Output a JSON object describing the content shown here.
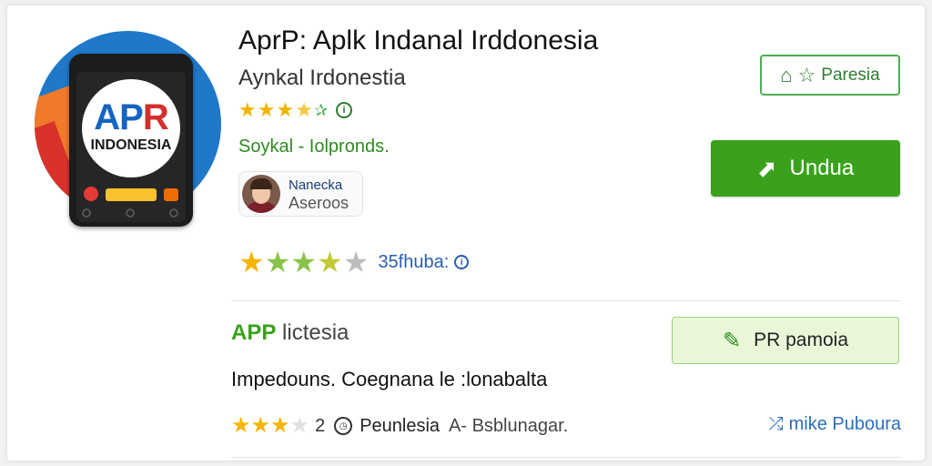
{
  "app": {
    "title": "AprP: Aplk Indanal Irddonesia",
    "subtitle": "Aynkal Irdonestia",
    "category": "Soykal - Iolpronds.",
    "icon_logo_text": "APR",
    "icon_logo_sub": "INDONESIA"
  },
  "developer": {
    "name": "Nanecka",
    "subtitle": "Aseroos"
  },
  "top_rating": {
    "stars": 3.5,
    "icon": "info-icon"
  },
  "rating_summary": {
    "stars": 3.5,
    "text": "35fhuba:",
    "icon": "info-icon"
  },
  "buttons": {
    "wishlist_label": "Paresia",
    "wishlist_icons": [
      "home-icon",
      "star-icon"
    ],
    "download_label": "Undua",
    "download_icon": "share-icon",
    "secondary_label": "PR pamoia",
    "secondary_icon": "edit-icon"
  },
  "section": {
    "title_brand": "APP",
    "title_rest": "lictesia",
    "description": "Impedouns. Coegnana le :lonabalta",
    "rating_stars": 3,
    "rating_count": "2",
    "label": "Peunlesia",
    "extra": "A- Bsblunagar.",
    "more_link": "mike Puboura",
    "more_icon": "link-icon"
  },
  "colors": {
    "accent_green": "#3aa11d",
    "star_gold": "#f5b400",
    "star_green": "#8bc34a",
    "link_blue": "#2a6fc0"
  }
}
